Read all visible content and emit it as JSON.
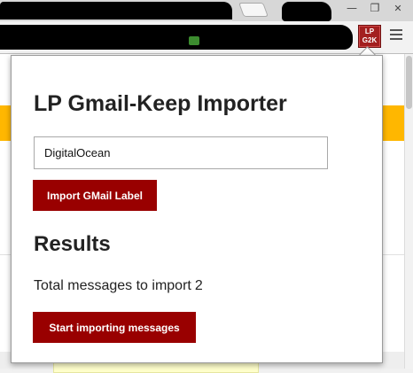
{
  "browser": {
    "extension_icon": {
      "line1": "LP",
      "line2": "G2K"
    }
  },
  "popup": {
    "title": "LP Gmail-Keep Importer",
    "label_input": {
      "value": "DigitalOcean"
    },
    "import_button": "Import GMail Label",
    "results_heading": "Results",
    "total_label": "Total messages to import",
    "total_count": "2",
    "start_button": "Start importing messages"
  },
  "colors": {
    "button_bg": "#990000",
    "button_text": "#ffffff",
    "extension_icon_bg": "#a31f1f",
    "underlying_banner": "#ffb700"
  }
}
